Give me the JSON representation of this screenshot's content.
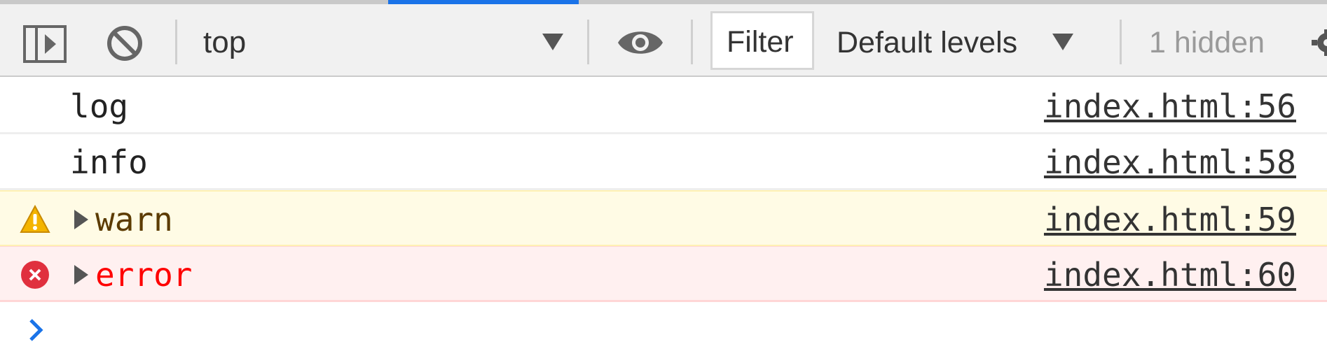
{
  "toolbar": {
    "context": "top",
    "filter_label": "Filter",
    "levels_label": "Default levels",
    "hidden_count": "1 hidden"
  },
  "console": {
    "messages": [
      {
        "level": "log",
        "text": "log",
        "source": "index.html:56",
        "icon": ""
      },
      {
        "level": "info",
        "text": "info",
        "source": "index.html:58",
        "icon": ""
      },
      {
        "level": "warn",
        "text": "warn",
        "source": "index.html:59",
        "icon": "warning-icon"
      },
      {
        "level": "error",
        "text": "error",
        "source": "index.html:60",
        "icon": "error-icon"
      }
    ]
  },
  "colors": {
    "accent": "#1a73e8",
    "warn_bg": "#fffbe5",
    "warn_text": "#5c3b00",
    "warn_icon": "#f4b400",
    "error_bg": "#fff0f0",
    "error_text": "#ff0000",
    "error_icon": "#e0303e"
  }
}
